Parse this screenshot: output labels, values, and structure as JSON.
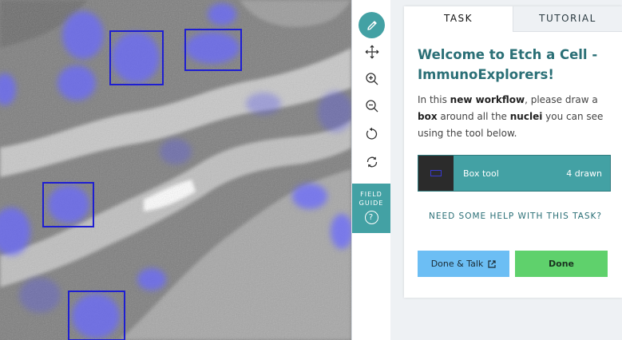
{
  "subject": {
    "annotation_count": 4
  },
  "toolbar": {
    "items": [
      "pencil-icon",
      "move-icon",
      "zoom-in-icon",
      "zoom-out-icon",
      "rotate-icon",
      "reset-icon"
    ],
    "field_guide_line1": "FIELD",
    "field_guide_line2": "GUIDE",
    "field_guide_help": "?"
  },
  "tabs": {
    "task": "TASK",
    "tutorial": "TUTORIAL"
  },
  "task": {
    "title": "Welcome to Etch a Cell - ImmunoExplorers!",
    "intro_1": "In this ",
    "intro_bold_1": "new workflow",
    "intro_2": ", please draw a ",
    "intro_bold_2": "box",
    "intro_3": " around all the ",
    "intro_bold_3": "nuclei",
    "intro_4": " you can see using the tool below.",
    "tool_label": "Box tool",
    "tool_count": "4 drawn",
    "help_link": "NEED SOME HELP WITH THIS TASK?"
  },
  "actions": {
    "done_talk": "Done & Talk",
    "done": "Done"
  },
  "colors": {
    "accent": "#43a1a4",
    "title": "#2a6f76",
    "done_talk": "#6cbef4",
    "done": "#5fd16c",
    "box_stroke": "#1e1ed2"
  }
}
